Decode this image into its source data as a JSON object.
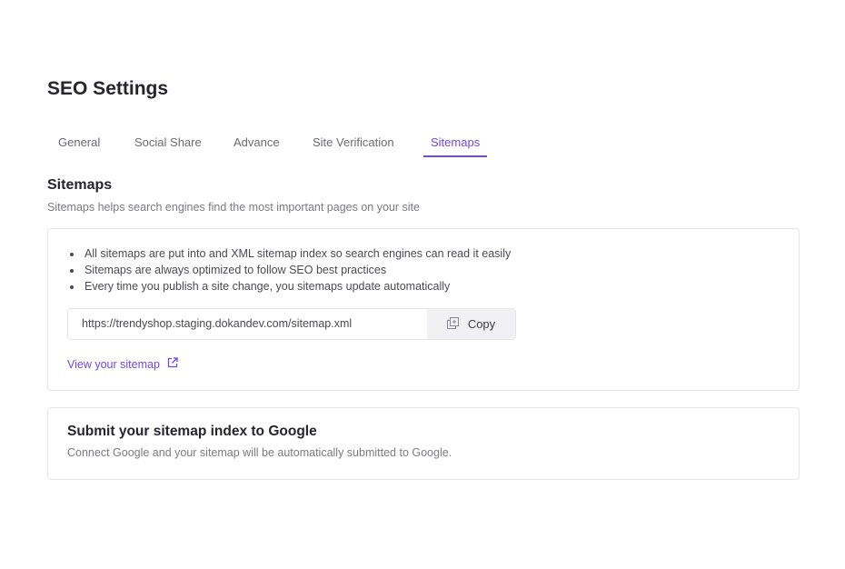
{
  "page_title": "SEO Settings",
  "tabs": [
    {
      "label": "General"
    },
    {
      "label": "Social Share"
    },
    {
      "label": "Advance"
    },
    {
      "label": "Site Verification"
    },
    {
      "label": "Sitemaps",
      "active": true
    }
  ],
  "section": {
    "title": "Sitemaps",
    "description": "Sitemaps helps search engines find the most important pages on your site"
  },
  "sitemap_card": {
    "bullets": [
      "All sitemaps are put into and XML sitemap index so search engines can read it easily",
      "Sitemaps are always optimized to follow SEO best practices",
      "Every time you publish a site change, you sitemaps update automatically"
    ],
    "url": "https://trendyshop.staging.dokandev.com/sitemap.xml",
    "copy_label": "Copy",
    "copy_icon": "copy-icon",
    "view_link": "View your sitemap",
    "view_icon": "external-link-icon"
  },
  "google_card": {
    "title": "Submit your sitemap index to Google",
    "description": "Connect Google and your sitemap will be automatically submitted to Google."
  },
  "colors": {
    "accent": "#7047eb",
    "text": "#25252d",
    "muted": "#7a7a84",
    "border": "#e6e6ea"
  }
}
